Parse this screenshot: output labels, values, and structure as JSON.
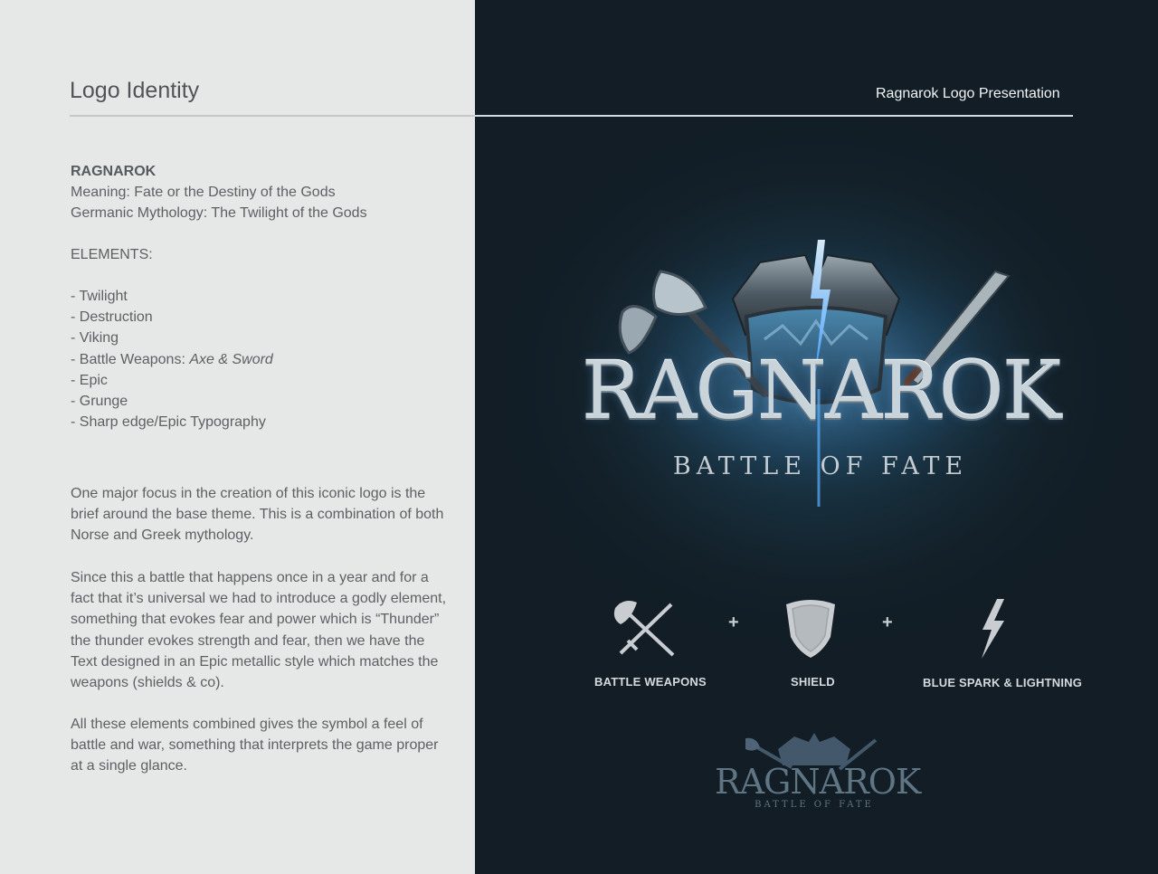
{
  "header": {
    "title": "Logo Identity",
    "subtitle": "Ragnarok Logo Presentation"
  },
  "intro": {
    "name": "RAGNAROK",
    "meaning": "Meaning: Fate or the Destiny of the Gods",
    "mythology": "Germanic Mythology: The Twilight of the Gods"
  },
  "elements": {
    "title": "ELEMENTS:",
    "items": [
      "- Twilight",
      "- Destruction",
      "- Viking",
      "- Battle Weapons: ",
      "- Epic",
      "- Grunge",
      "- Sharp edge/Epic Typography"
    ],
    "weapons_emphasis": "Axe & Sword"
  },
  "paragraphs": [
    "One major focus in the creation of this iconic logo is the brief around the base theme. This is a combination of both Norse and Greek mythology.",
    "Since this a battle that happens once in a year and for a fact that it’s universal we had to introduce a godly element, something that evokes fear and power which is “Thunder” the thunder evokes strength and fear, then we have the Text designed in an Epic metallic style which matches the weapons (shields & co).",
    "All these elements combined gives the symbol a feel of battle and war, something that interprets the game proper at a single glance."
  ],
  "logo": {
    "title": "RAGNAROK",
    "tagline": "BATTLE OF FATE"
  },
  "logo_elements": [
    {
      "label": "BATTLE WEAPONS",
      "icon": "crossed-axe-sword-icon"
    },
    {
      "label": "SHIELD",
      "icon": "shield-icon"
    },
    {
      "label": "BLUE SPARK & LIGHTNING",
      "icon": "lightning-icon"
    }
  ],
  "plus_symbol": "+",
  "small_logo": {
    "title": "RAGNAROK",
    "tagline": "BATTLE OF FATE"
  },
  "colors": {
    "left_background": "#e6e8e7",
    "right_background": "#132029",
    "accent_glow": "#4aa3ff",
    "text_gray": "#5d6164"
  }
}
